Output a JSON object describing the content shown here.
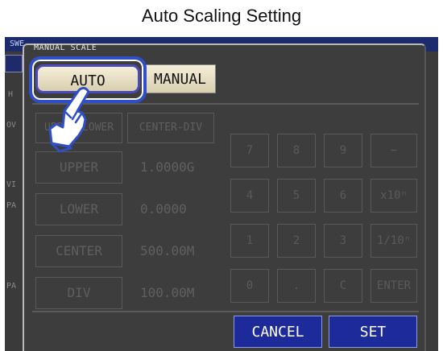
{
  "caption": "Auto Scaling Setting",
  "screen": {
    "topbar_label": "SWE",
    "side_labels": [
      "H",
      "OV",
      "VI",
      "PA",
      "PA"
    ]
  },
  "dialog": {
    "title": "MANUAL SCALE",
    "mode_buttons": {
      "auto": "AUTO",
      "manual": "MANUAL"
    },
    "mode_selected": "AUTO",
    "selector_buttons": {
      "upper_lower": "UPPER-LOWER",
      "center_div": "CENTER-DIV"
    },
    "fields": [
      {
        "label": "UPPER",
        "value": "1.0000G"
      },
      {
        "label": "LOWER",
        "value": "0.0000"
      },
      {
        "label": "CENTER",
        "value": "500.00M"
      },
      {
        "label": "DIV",
        "value": "100.00M"
      }
    ],
    "keypad": [
      [
        "7",
        "8",
        "9",
        "−"
      ],
      [
        "4",
        "5",
        "6",
        "x10ⁿ"
      ],
      [
        "1",
        "2",
        "3",
        "1/10ⁿ"
      ],
      [
        "0",
        ".",
        "C",
        "ENTER"
      ]
    ],
    "cancel_label": "CANCEL",
    "set_label": "SET"
  },
  "icons": {
    "pointer": "hand-pointer-icon"
  }
}
